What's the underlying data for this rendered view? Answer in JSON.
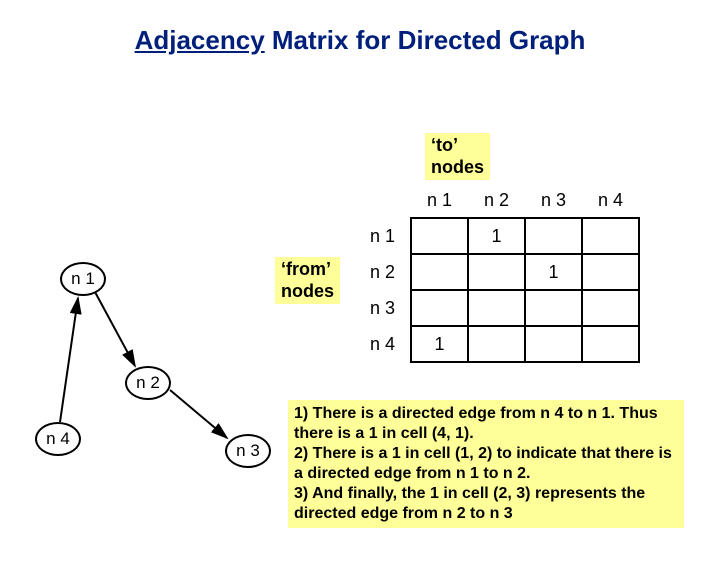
{
  "title_part1": "Adjacency",
  "title_part2": " Matrix for Directed Graph",
  "to_label_l1": "‘to’",
  "to_label_l2": "nodes",
  "from_label_l1": "‘from’",
  "from_label_l2": "nodes",
  "headers": {
    "c1": "n 1",
    "c2": "n 2",
    "c3": "n 3",
    "c4": "n 4"
  },
  "rows": {
    "r1": {
      "label": "n 1",
      "c1": "",
      "c2": "1",
      "c3": "",
      "c4": ""
    },
    "r2": {
      "label": "n 2",
      "c1": "",
      "c2": "",
      "c3": "1",
      "c4": ""
    },
    "r3": {
      "label": "n 3",
      "c1": "",
      "c2": "",
      "c3": "",
      "c4": ""
    },
    "r4": {
      "label": "n 4",
      "c1": "1",
      "c2": "",
      "c3": "",
      "c4": ""
    }
  },
  "nodes": {
    "n1": "n 1",
    "n2": "n 2",
    "n3": "n 3",
    "n4": "n 4"
  },
  "explanation": "1) There is a directed edge from n 4 to n 1. Thus there is a 1 in cell (4, 1).\n2) There is a 1 in cell (1, 2) to indicate that there is a directed edge from n 1 to n 2.\n3) And finally, the 1 in cell (2, 3) represents the directed edge from n 2 to n 3",
  "chart_data": {
    "type": "table",
    "title": "Adjacency Matrix for Directed Graph",
    "row_labels": [
      "n1",
      "n2",
      "n3",
      "n4"
    ],
    "col_labels": [
      "n1",
      "n2",
      "n3",
      "n4"
    ],
    "matrix": [
      [
        0,
        1,
        0,
        0
      ],
      [
        0,
        0,
        1,
        0
      ],
      [
        0,
        0,
        0,
        0
      ],
      [
        1,
        0,
        0,
        0
      ]
    ],
    "edges": [
      [
        "n1",
        "n2"
      ],
      [
        "n2",
        "n3"
      ],
      [
        "n4",
        "n1"
      ]
    ]
  }
}
